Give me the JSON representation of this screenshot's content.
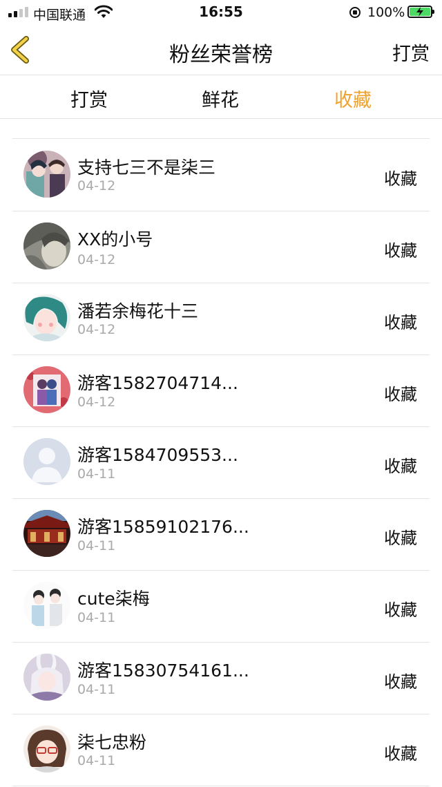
{
  "status_bar": {
    "carrier": "中国联通",
    "time": "16:55",
    "battery": "100%"
  },
  "nav": {
    "title": "粉丝荣誉榜",
    "right": "打赏"
  },
  "tabs": [
    {
      "label": "打赏",
      "active": false
    },
    {
      "label": "鲜花",
      "active": false
    },
    {
      "label": "收藏",
      "active": true
    }
  ],
  "accent_color": "#f0a22e",
  "list": [
    {
      "name": "支持七三不是柒三",
      "date": "04-12",
      "action": "收藏",
      "avatar": "anime-couple-avatar"
    },
    {
      "name": "XX的小号",
      "date": "04-12",
      "action": "收藏",
      "avatar": "grey-portrait-avatar"
    },
    {
      "name": "潘若余梅花十三",
      "date": "04-12",
      "action": "收藏",
      "avatar": "green-hair-girl-avatar"
    },
    {
      "name": "游客1582704714...",
      "date": "04-12",
      "action": "收藏",
      "avatar": "red-couple-avatar"
    },
    {
      "name": "游客1584709553...",
      "date": "04-11",
      "action": "收藏",
      "avatar": "default-user-avatar"
    },
    {
      "name": "游客15859102176...",
      "date": "04-11",
      "action": "收藏",
      "avatar": "red-building-avatar"
    },
    {
      "name": "cute柒梅",
      "date": "04-11",
      "action": "收藏",
      "avatar": "sketch-couple-avatar"
    },
    {
      "name": "游客15830754161...",
      "date": "04-11",
      "action": "收藏",
      "avatar": "bunny-girl-avatar"
    },
    {
      "name": "柒七忠粉",
      "date": "04-11",
      "action": "收藏",
      "avatar": "glasses-girl-avatar"
    }
  ]
}
